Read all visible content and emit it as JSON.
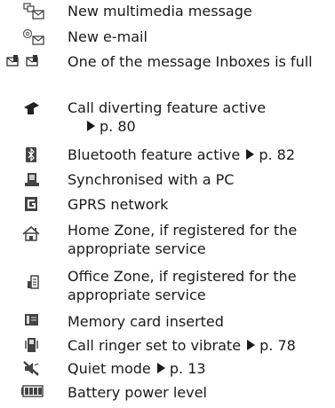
{
  "arrow_glyph": "triangle-right-icon",
  "rows": [
    {
      "icon": "multimedia-message-icon",
      "text": "New multimedia message",
      "ref": ""
    },
    {
      "icon": "email-icon",
      "text": "New e-mail",
      "ref": ""
    },
    {
      "icon": "inbox-full-icon",
      "text": "One of the message Inboxes is full",
      "ref": ""
    },
    {
      "icon": "call-divert-icon",
      "text": "Call diverting feature active",
      "ref": "p. 80"
    },
    {
      "icon": "bluetooth-icon",
      "text": "Bluetooth feature active",
      "ref": "p. 82"
    },
    {
      "icon": "pc-sync-icon",
      "text": "Synchronised with a PC",
      "ref": ""
    },
    {
      "icon": "gprs-icon",
      "text": "GPRS network",
      "ref": ""
    },
    {
      "icon": "home-zone-icon",
      "text": "Home Zone, if registered for the appropriate service",
      "ref": ""
    },
    {
      "icon": "office-zone-icon",
      "text": "Office Zone, if registered for the appropriate service",
      "ref": ""
    },
    {
      "icon": "memory-card-icon",
      "text": "Memory card inserted",
      "ref": ""
    },
    {
      "icon": "vibrate-icon",
      "text": "Call ringer set to vibrate",
      "ref": "p. 78"
    },
    {
      "icon": "quiet-mode-icon",
      "text": "Quiet mode",
      "ref": "p. 13"
    },
    {
      "icon": "battery-icon",
      "text": "Battery power level",
      "ref": ""
    }
  ]
}
